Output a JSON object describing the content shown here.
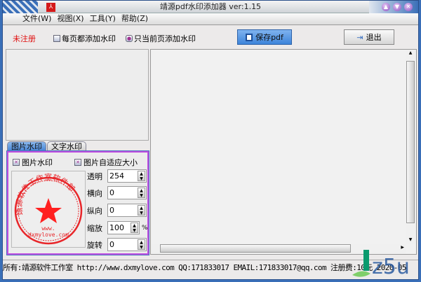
{
  "title": "靖源pdf水印添加器 ver:1.15",
  "menu": [
    "文件(W)",
    "视图(X)",
    "工具(Y)",
    "帮助(Z)"
  ],
  "toolbar": {
    "unregistered": "未注册",
    "every_page": "每页都添加水印",
    "current_page": "只当前页添加水印",
    "save": "保存pdf",
    "exit": "退出"
  },
  "tabs": [
    "图片水印",
    "文字水印"
  ],
  "panel": {
    "image_watermark": "图片水印",
    "auto_size": "图片自适应大小",
    "fields": [
      {
        "label": "透明",
        "value": "254"
      },
      {
        "label": "横向",
        "value": "0"
      },
      {
        "label": "纵向",
        "value": "0"
      },
      {
        "label": "缩放",
        "value": "100",
        "unit": "%"
      },
      {
        "label": "旋转",
        "value": "0"
      }
    ],
    "stamp_text": "靖源软件工作室软件部",
    "stamp_www": "www.",
    "stamp_url": "dxmylove.com"
  },
  "status": "所有:靖源软件工作室 http://www.dxmylove.com QQ:171833017 EMAIL:171833017@qq.com 注册费:10元 2020-05",
  "watermark_logo": "jz5u",
  "colors": {
    "accent": "#3d84da",
    "unregistered": "#e01010",
    "stamp": "#e8262a",
    "panel_border": "#c050e0"
  }
}
